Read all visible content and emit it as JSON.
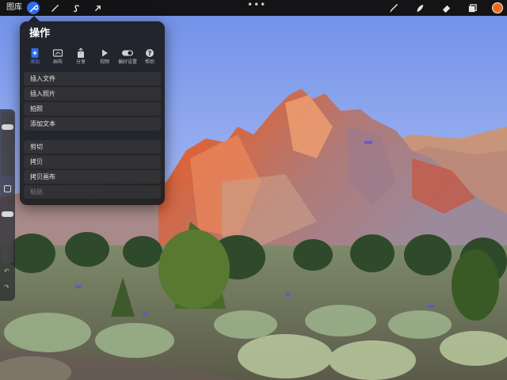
{
  "toolbar": {
    "gallery_label": "图库",
    "left_tools": [
      {
        "name": "actions-wrench-icon",
        "active": true
      },
      {
        "name": "adjustments-wand-icon",
        "active": false
      },
      {
        "name": "selection-s-icon",
        "active": false
      },
      {
        "name": "transform-arrow-icon",
        "active": false
      }
    ],
    "more_label": "•••",
    "right_tools": [
      "brush-icon",
      "smudge-icon",
      "eraser-icon",
      "layers-icon"
    ],
    "current_color": "#f06a1c"
  },
  "actions_popover": {
    "title": "操作",
    "tabs": [
      {
        "label": "添加",
        "icon": "add-file-icon",
        "active": true
      },
      {
        "label": "画布",
        "icon": "canvas-icon",
        "active": false
      },
      {
        "label": "分享",
        "icon": "share-icon",
        "active": false
      },
      {
        "label": "视频",
        "icon": "video-play-icon",
        "active": false
      },
      {
        "label": "偏好设置",
        "icon": "toggle-icon",
        "active": false
      },
      {
        "label": "帮助",
        "icon": "help-icon",
        "active": false
      }
    ],
    "items": [
      {
        "label": "插入文件",
        "disabled": false
      },
      {
        "label": "插入照片",
        "disabled": false
      },
      {
        "label": "拍照",
        "disabled": false
      },
      {
        "label": "添加文本",
        "disabled": false
      },
      {
        "label": "剪切",
        "disabled": false
      },
      {
        "label": "拷贝",
        "disabled": false
      },
      {
        "label": "拷贝画布",
        "disabled": false
      },
      {
        "label": "粘贴",
        "disabled": true
      }
    ]
  },
  "sidebar": {
    "brush_size_level": 0.2,
    "opacity_level": 0.2
  },
  "colors": {
    "accent": "#2f6df0",
    "active_tab_label": "#5b8cff",
    "toolbar_bg": "#141416"
  }
}
